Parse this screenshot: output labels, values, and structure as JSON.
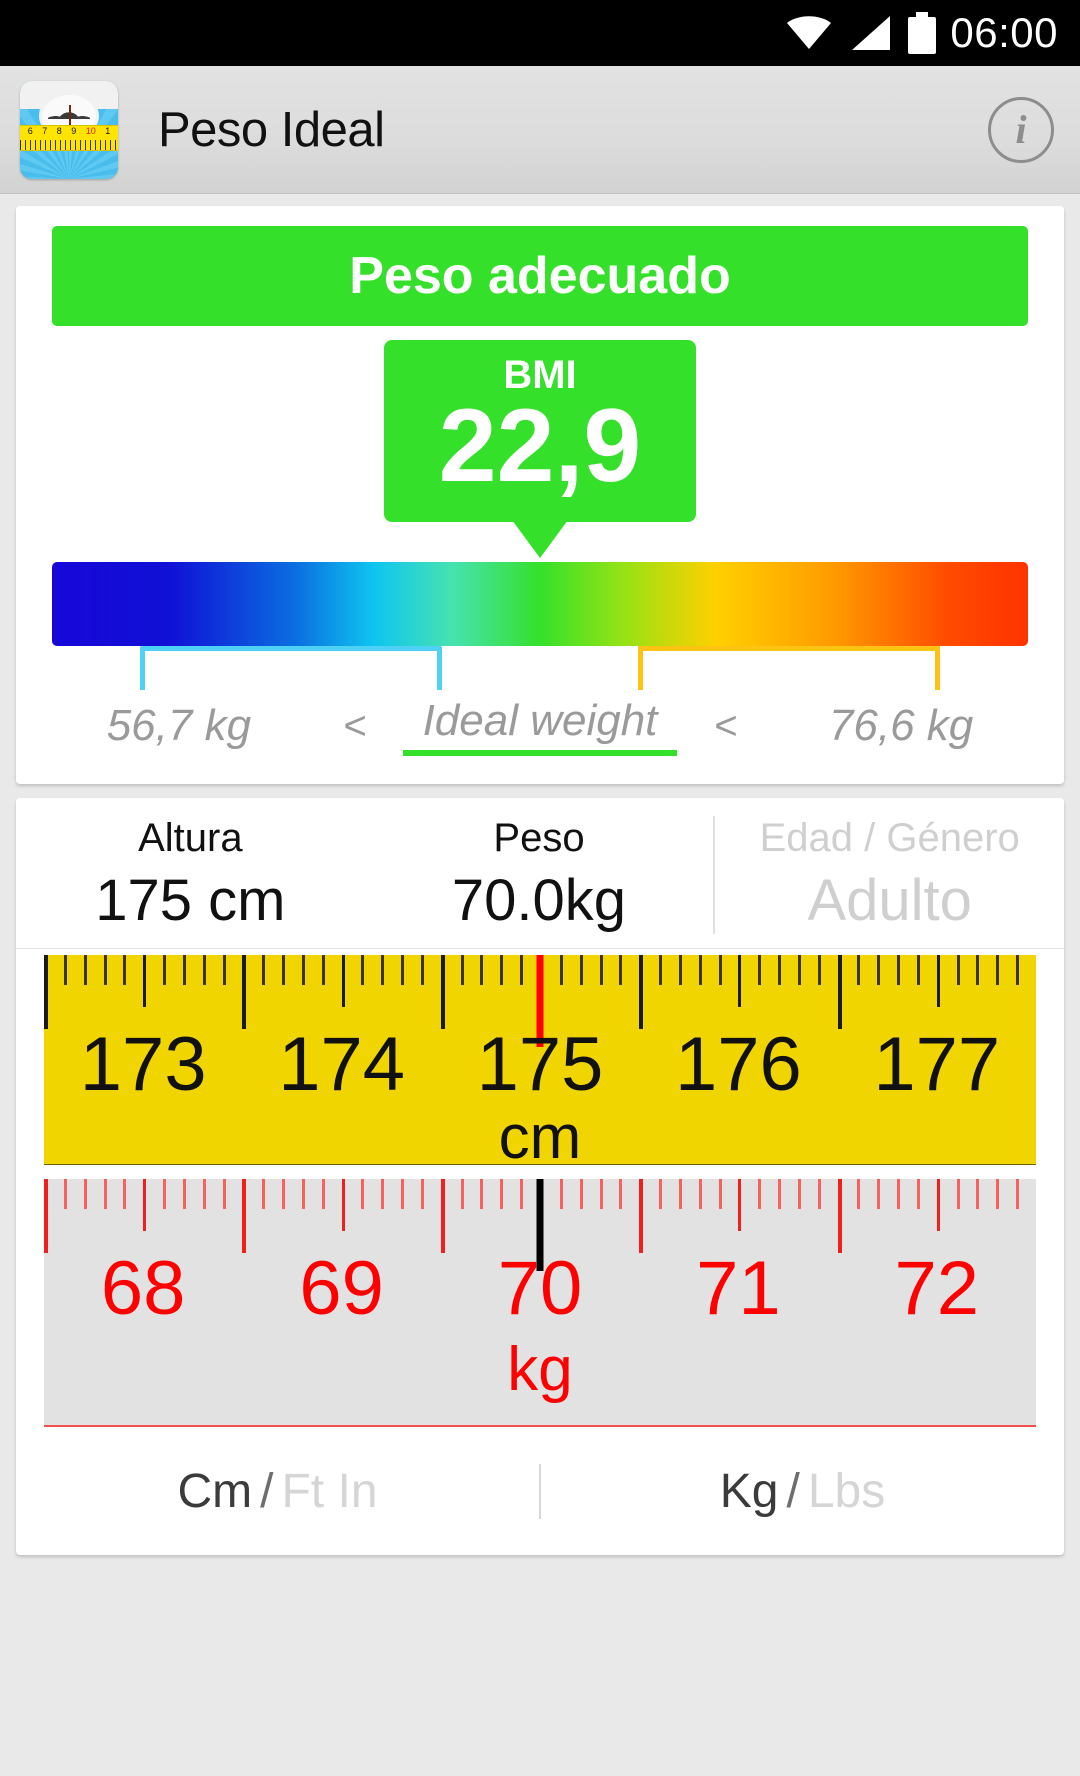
{
  "status_bar": {
    "time": "06:00",
    "icons": [
      "wifi-icon",
      "signal-icon",
      "battery-icon"
    ]
  },
  "app_bar": {
    "title": "Peso Ideal",
    "app_icon": "scale-measuring-tape-icon",
    "app_icon_tape_numbers": [
      "6",
      "7",
      "8",
      "9",
      "10",
      "1"
    ],
    "info_button": "i"
  },
  "bmi_card": {
    "status_text": "Peso adecuado",
    "status_color": "#35e02b",
    "bmi_label": "BMI",
    "bmi_value": "22,9",
    "gradient_colors": [
      "#1707d8",
      "#0fc5f0",
      "#35e02b",
      "#ffd000",
      "#ff3300"
    ],
    "lower_bracket_color": "#4fd0f5",
    "upper_bracket_color": "#fcc315",
    "min_weight": "56,7 kg",
    "less_than_1": "<",
    "ideal_label": "Ideal weight",
    "less_than_2": "<",
    "max_weight": "76,6 kg"
  },
  "measures": {
    "height_label": "Altura",
    "height_value": "175 cm",
    "weight_label": "Peso",
    "weight_value": "70.0kg",
    "age_label": "Edad / Género",
    "age_value": "Adulto"
  },
  "height_ruler": {
    "unit": "cm",
    "numbers": [
      "173",
      "174",
      "175",
      "176",
      "177"
    ],
    "current": "175",
    "background": "#f0d500",
    "cursor_color": "#ff0000"
  },
  "weight_ruler": {
    "unit": "kg",
    "numbers": [
      "68",
      "69",
      "70",
      "71",
      "72"
    ],
    "current": "70",
    "background": "#e2e2e2",
    "cursor_color": "#000000",
    "tick_color": "#f21f1f"
  },
  "unit_toggle": {
    "length_on": "Cm",
    "length_sep": "/",
    "length_off": "Ft In",
    "mass_on": "Kg",
    "mass_sep": "/",
    "mass_off": "Lbs"
  }
}
